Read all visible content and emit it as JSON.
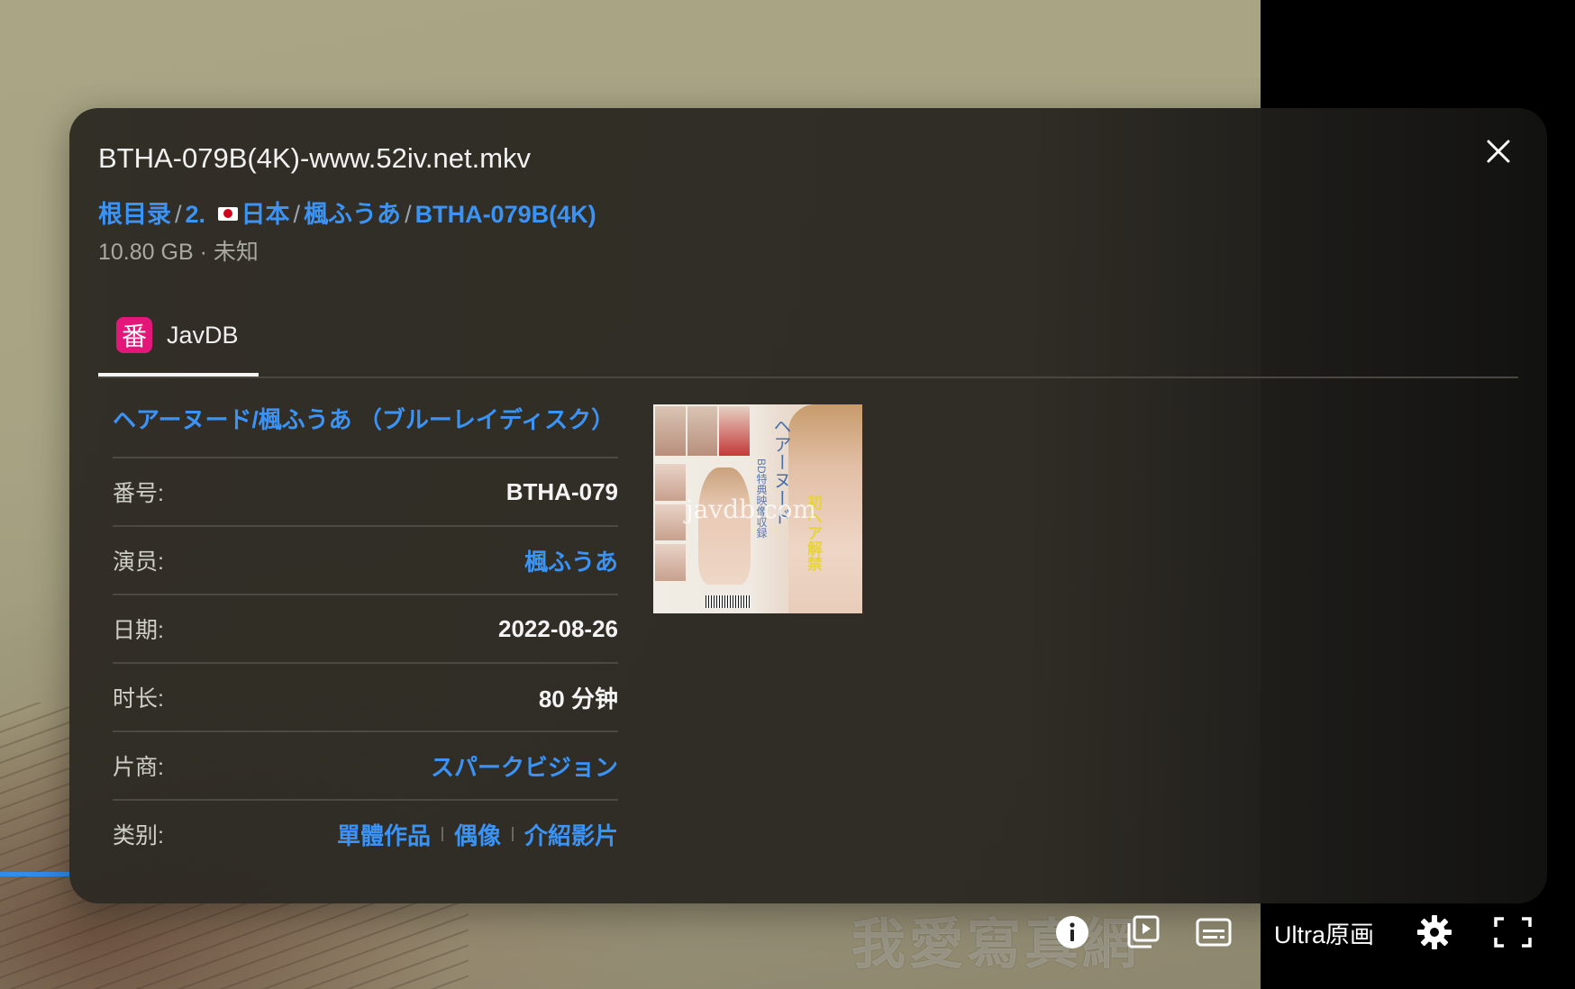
{
  "file": {
    "name": "BTHA-079B(4K)-www.52iv.net.mkv",
    "breadcrumb": [
      {
        "label": "根目录"
      },
      {
        "label": "2. "
      },
      {
        "label": "日本"
      },
      {
        "label": "楓ふうあ"
      },
      {
        "label": "BTHA-079B(4K)"
      }
    ],
    "size": "10.80 GB",
    "meta_sep": " · ",
    "status": "未知"
  },
  "tabs": [
    {
      "icon_char": "番",
      "icon": "javdb-icon",
      "label": "JavDB",
      "active": true
    }
  ],
  "movie": {
    "title": "ヘアーヌード/楓ふうあ （ブルーレイディスク）",
    "fields": [
      {
        "label": "番号:",
        "value": "BTHA-079"
      },
      {
        "label": "演员:",
        "value": "楓ふうあ"
      },
      {
        "label": "日期:",
        "value": "2022-08-26"
      },
      {
        "label": "时长:",
        "value": "80 分钟"
      },
      {
        "label": "片商:",
        "value": "スパークビジョン"
      },
      {
        "label": "类别:",
        "genres": [
          "單體作品",
          "偶像",
          "介紹影片"
        ]
      }
    ],
    "cover": {
      "vertical_title": "ヘアーヌード",
      "subtitle": "BD特典映像収録",
      "highlight": "初ヘア解禁",
      "watermark": "javdb.com"
    }
  },
  "player": {
    "watermark": "我愛寫真網",
    "quality": "Ultra原画",
    "icons": [
      "info-icon",
      "playlist-icon",
      "subtitles-icon",
      "settings-icon",
      "fullscreen-icon"
    ]
  },
  "colors": {
    "link": "#3a93f5",
    "tab_icon": "#e3177a"
  }
}
